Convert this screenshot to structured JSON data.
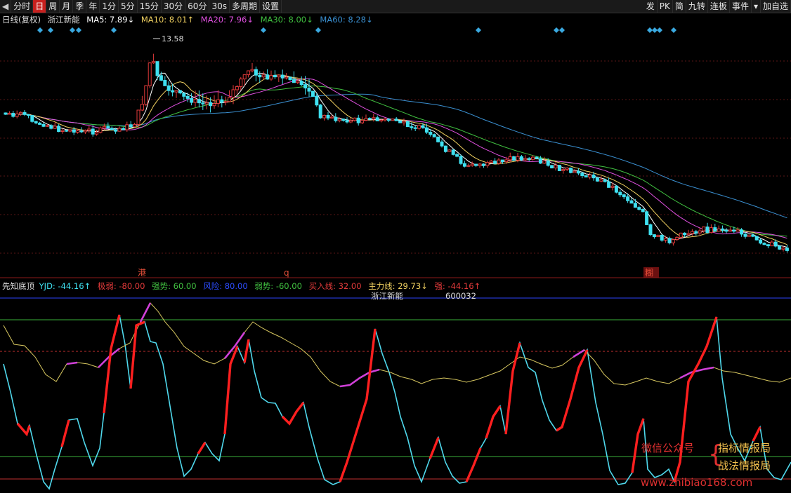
{
  "toolbar": {
    "items": [
      {
        "label": "分时"
      },
      {
        "label": "日",
        "active": true
      },
      {
        "label": "周"
      },
      {
        "label": "月"
      },
      {
        "label": "季"
      },
      {
        "label": "年"
      },
      {
        "label": "1分"
      },
      {
        "label": "5分"
      },
      {
        "label": "15分"
      },
      {
        "label": "30分"
      },
      {
        "label": "60分"
      },
      {
        "label": "30s"
      },
      {
        "label": "多周期"
      },
      {
        "label": "设置"
      }
    ],
    "right_items": [
      {
        "label": "发"
      },
      {
        "label": "PK"
      },
      {
        "label": "简"
      },
      {
        "label": "九转"
      },
      {
        "label": "连板"
      },
      {
        "label": "事件"
      },
      {
        "label": "加自选"
      }
    ]
  },
  "price_info": {
    "mode": "日线(复权)",
    "stock": "浙江新能",
    "ma5": "MA5: 7.89↓",
    "ma10": "MA10: 8.01↑",
    "ma20": "MA20: 7.96↓",
    "ma30": "MA30: 8.00↓",
    "ma60": "MA60: 8.28↓"
  },
  "price_chart": {
    "high_label": "13.58",
    "markers": [
      "港",
      "q",
      "糊"
    ],
    "colors": {
      "up": "#e23a3a",
      "down": "#3fe0f0",
      "ma5": "#ffffff",
      "ma10": "#f0d060",
      "ma20": "#e050e0",
      "ma30": "#40c040",
      "ma60": "#3a8fd0"
    }
  },
  "indicator_info": {
    "name": "先知底顶",
    "yjd": "YJD: -44.16↑",
    "jiruo": "极弱: -80.00",
    "qiangshi": "强势: 60.00",
    "fengxian": "风险: 80.00",
    "ruoshi": "弱势: -60.00",
    "mairu": "买入线: 32.00",
    "zhulixian": "主力线: 29.73↓",
    "qiang": "强: -44.16↑"
  },
  "indicator_chart": {
    "stock": "浙江新能",
    "code": "600032"
  },
  "watermark": {
    "line1": "微信公众号",
    "line2": "指标情报局",
    "line3": "战法情报局",
    "url": "www.zhibiao168.com"
  }
}
